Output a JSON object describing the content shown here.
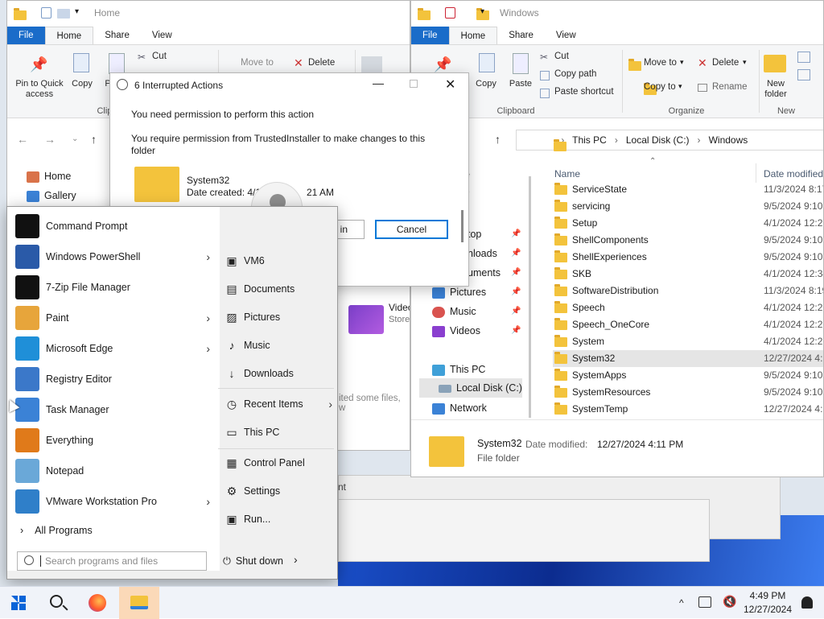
{
  "left_explorer": {
    "title": "Home",
    "tabs": {
      "file": "File",
      "home": "Home",
      "share": "Share",
      "view": "View"
    },
    "ribbon": {
      "pin": "Pin to Quick access",
      "copy": "Copy",
      "paste": "P",
      "cut": "Cut",
      "copy_path": "Copy path",
      "move_to": "Move to",
      "delete": "Delete",
      "clipboard_group": "Clipb"
    },
    "nav": [
      {
        "label": "Home",
        "icon": "home-icon"
      },
      {
        "label": "Gallery",
        "icon": "gallery-icon"
      }
    ],
    "content_item": {
      "name": "Video",
      "sub": "Store"
    },
    "status_fragment": "ited some files, w",
    "fragment2": "nt"
  },
  "right_explorer": {
    "title": "Windows",
    "tabs": {
      "file": "File",
      "home": "Home",
      "share": "Share",
      "view": "View"
    },
    "ribbon": {
      "pin": "Pin to Quick access",
      "copy": "Copy",
      "paste": "Paste",
      "cut": "Cut",
      "copy_path": "Copy path",
      "paste_shortcut": "Paste shortcut",
      "move_to": "Move to",
      "copy_to": "Copy to",
      "delete": "Delete",
      "rename": "Rename",
      "new_folder": "New folder",
      "groups": {
        "clipboard": "Clipboard",
        "organize": "Organize",
        "new": "New"
      }
    },
    "breadcrumb": [
      "This PC",
      "Local Disk (C:)",
      "Windows"
    ],
    "columns": {
      "name": "Name",
      "date": "Date modified"
    },
    "files": [
      {
        "name": "ServiceState",
        "date": "11/3/2024 8:17"
      },
      {
        "name": "servicing",
        "date": "9/5/2024 9:10 P"
      },
      {
        "name": "Setup",
        "date": "4/1/2024 12:29"
      },
      {
        "name": "ShellComponents",
        "date": "9/5/2024 9:10 P"
      },
      {
        "name": "ShellExperiences",
        "date": "9/5/2024 9:10 P"
      },
      {
        "name": "SKB",
        "date": "4/1/2024 12:34"
      },
      {
        "name": "SoftwareDistribution",
        "date": "11/3/2024 8:19"
      },
      {
        "name": "Speech",
        "date": "4/1/2024 12:26"
      },
      {
        "name": "Speech_OneCore",
        "date": "4/1/2024 12:26"
      },
      {
        "name": "System",
        "date": "4/1/2024 12:26"
      },
      {
        "name": "System32",
        "date": "12/27/2024 4:1"
      },
      {
        "name": "SystemApps",
        "date": "9/5/2024 9:10 P"
      },
      {
        "name": "SystemResources",
        "date": "9/5/2024 9:10 P"
      },
      {
        "name": "SystemTemp",
        "date": "12/27/2024 4:1"
      }
    ],
    "nav": [
      {
        "label": "e",
        "pinned": false
      },
      {
        "label": "y",
        "pinned": false
      },
      {
        "label": "top",
        "pinned": true
      },
      {
        "label": "nloads",
        "pinned": true
      },
      {
        "label": "uments",
        "pinned": true
      },
      {
        "label": "Pictures",
        "pinned": true
      },
      {
        "label": "Music",
        "pinned": true
      },
      {
        "label": "Videos",
        "pinned": true
      },
      {
        "label": "This PC",
        "pinned": false
      },
      {
        "label": "Local Disk (C:)",
        "pinned": false
      },
      {
        "label": "Network",
        "pinned": false
      }
    ],
    "details": {
      "name": "System32",
      "modified_label": "Date modified:",
      "modified": "12/27/2024 4:11 PM",
      "type": "File folder"
    }
  },
  "dialog": {
    "title": "6 Interrupted Actions",
    "message": "You need permission to perform this action",
    "detail": "You require permission from TrustedInstaller to make changes to this folder",
    "item_name": "System32",
    "item_date": "Date created: 4/1",
    "item_time": "21 AM",
    "try_again": "in",
    "cancel": "Cancel"
  },
  "start_menu": {
    "programs": [
      {
        "label": "Command Prompt",
        "icon": "cmd-icon",
        "submenu": false
      },
      {
        "label": "Windows PowerShell",
        "icon": "powershell-icon",
        "submenu": true
      },
      {
        "label": "7-Zip File Manager",
        "icon": "7zip-icon",
        "submenu": false
      },
      {
        "label": "Paint",
        "icon": "paint-icon",
        "submenu": true
      },
      {
        "label": "Microsoft Edge",
        "icon": "edge-icon",
        "submenu": true
      },
      {
        "label": "Registry Editor",
        "icon": "registry-icon",
        "submenu": false
      },
      {
        "label": "Task Manager",
        "icon": "task-manager-icon",
        "submenu": false
      },
      {
        "label": "Everything",
        "icon": "everything-icon",
        "submenu": false
      },
      {
        "label": "Notepad",
        "icon": "notepad-icon",
        "submenu": false
      },
      {
        "label": "VMware Workstation Pro",
        "icon": "vmware-icon",
        "submenu": true
      }
    ],
    "all_programs": "All Programs",
    "search_placeholder": "Search programs and files",
    "places": [
      {
        "label": "VM6",
        "icon": "user-folder-icon"
      },
      {
        "label": "Documents",
        "icon": "documents-icon"
      },
      {
        "label": "Pictures",
        "icon": "pictures-icon"
      },
      {
        "label": "Music",
        "icon": "music-icon"
      },
      {
        "label": "Downloads",
        "icon": "downloads-icon"
      },
      {
        "label": "Recent Items",
        "icon": "recent-icon"
      },
      {
        "label": "This PC",
        "icon": "this-pc-icon"
      },
      {
        "label": "Control Panel",
        "icon": "control-panel-icon"
      },
      {
        "label": "Settings",
        "icon": "settings-icon"
      },
      {
        "label": "Run...",
        "icon": "run-icon"
      }
    ],
    "shutdown": "Shut down"
  },
  "taskbar": {
    "time": "4:49 PM",
    "date": "12/27/2024",
    "tray_up": "^"
  },
  "colors": {
    "accent": "#1a6cc9",
    "folder": "#f3c33c",
    "start_bg": "#f0f0f0"
  }
}
